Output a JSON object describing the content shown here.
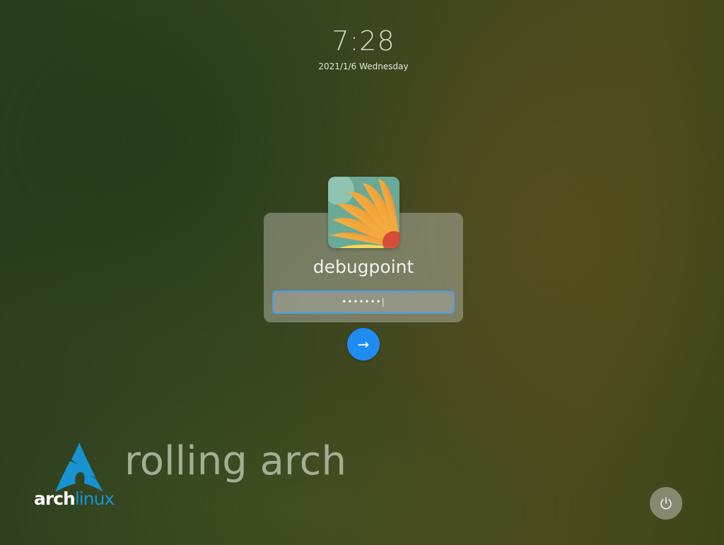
{
  "lock_screen": {
    "time": "7:28",
    "date": "2021/1/6 Wednesday"
  },
  "user": {
    "username": "debugpoint",
    "password_mask": "•••••••|",
    "avatar_icon": "flower-avatar-icon"
  },
  "actions": {
    "login_icon": "arrow-right-icon",
    "login_glyph": "→",
    "power_icon": "power-icon"
  },
  "branding": {
    "logo_arch": "arch",
    "logo_linux": "linux",
    "logo_dot": ".",
    "tagline": "rolling arch"
  },
  "colors": {
    "accent": "#1e8cf0",
    "arch_blue": "#1793d1",
    "field_border": "#4a9eea"
  }
}
